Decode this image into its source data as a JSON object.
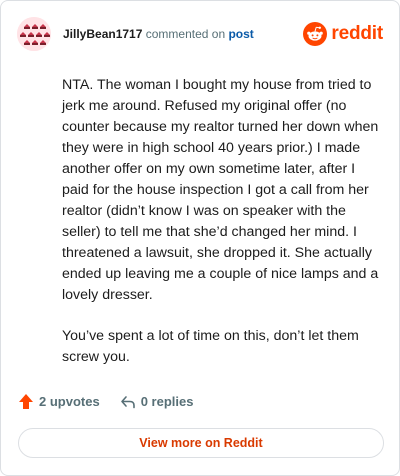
{
  "header": {
    "username": "JillyBean1717",
    "action_text": "commented on",
    "target_link": "post",
    "brand_name": "reddit",
    "brand_color": "#ff4500",
    "avatar_icon": "snoo-pattern-avatar"
  },
  "comment": {
    "paragraphs": [
      "NTA. The woman I bought my house from tried to jerk me around. Refused my original offer (no counter because my realtor turned her down when they were in high school 40 years prior.) I made another offer on my own sometime later, after I paid for the house inspection I got a call from her realtor (didn’t know I was on speaker with the seller) to tell me that she’d changed her mind. I threatened a lawsuit, she dropped it. She actually ended up leaving me a couple of nice lamps and a lovely dresser.",
      "You’ve spent a lot of time on this, don’t let them screw you."
    ]
  },
  "actions": {
    "upvotes_label": "2 upvotes",
    "replies_label": "0 replies",
    "upvote_icon": "upvote-arrow-icon",
    "reply_icon": "reply-arrow-icon"
  },
  "footer": {
    "view_more_label": "View more on Reddit"
  }
}
